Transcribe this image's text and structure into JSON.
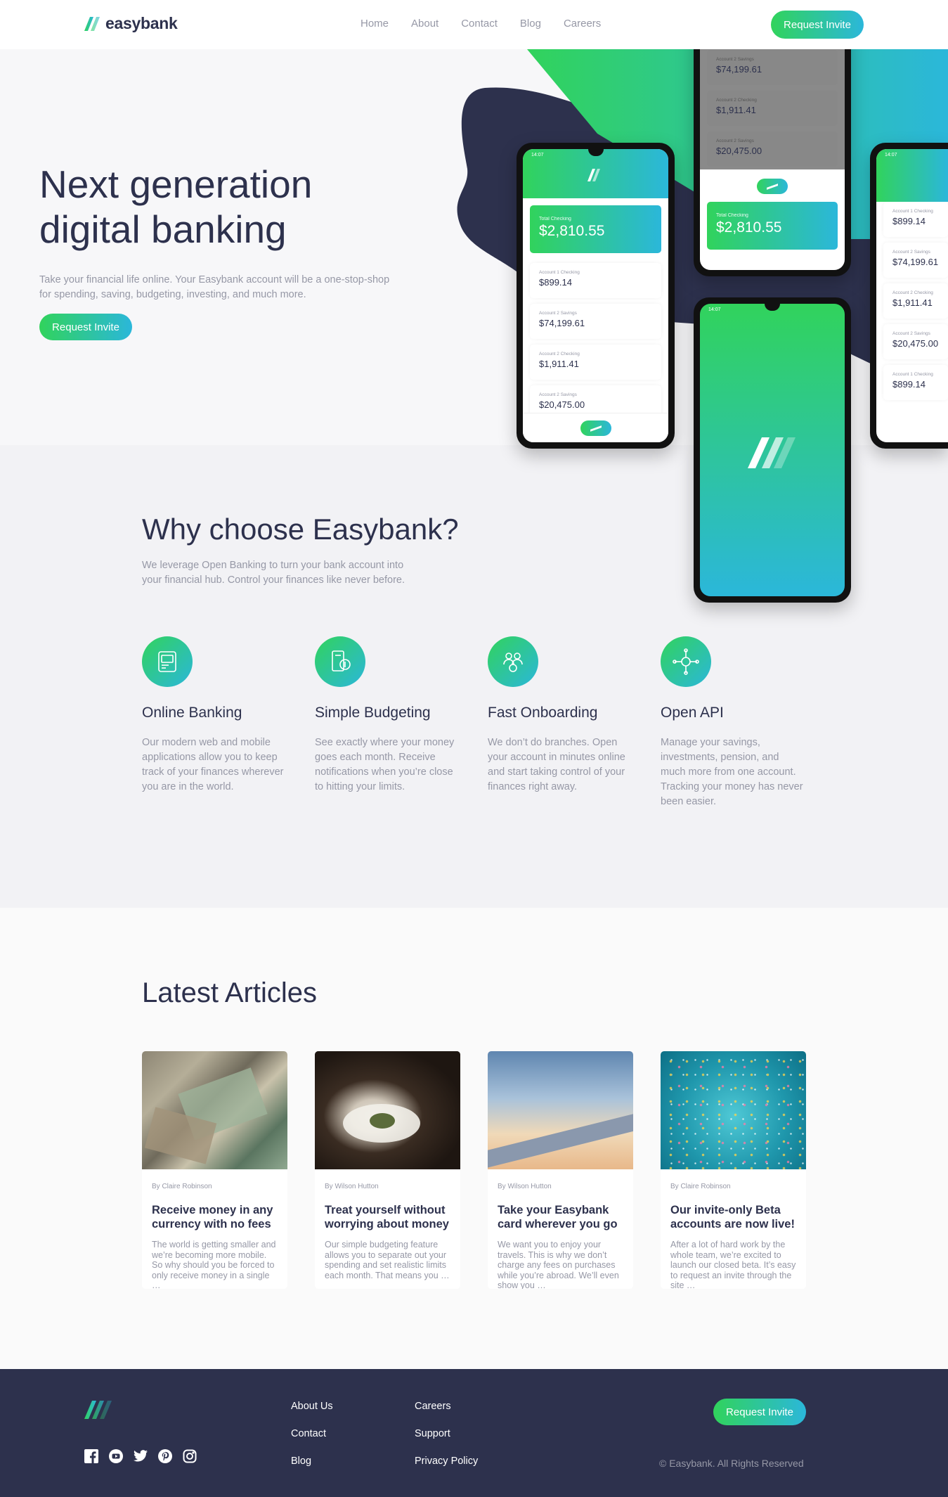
{
  "header": {
    "brand": "easybank",
    "nav": [
      "Home",
      "About",
      "Contact",
      "Blog",
      "Careers"
    ],
    "cta": "Request Invite"
  },
  "hero": {
    "title_line1": "Next generation",
    "title_line2": "digital banking",
    "description": "Take your financial life online. Your Easybank account will be a one-stop-shop for spending, saving, budgeting, investing, and much more.",
    "cta": "Request Invite"
  },
  "phones": {
    "time": "14:07",
    "total_label": "Total Checking",
    "total_value": "$2,810.55",
    "accounts": [
      {
        "label": "Account 1 Checking",
        "value": "$899.14"
      },
      {
        "label": "Account 2 Savings",
        "value": "$74,199.61"
      },
      {
        "label": "Account 2 Checking",
        "value": "$1,911.41"
      },
      {
        "label": "Account 2 Savings",
        "value": "$20,475.00"
      },
      {
        "label": "Account 1 Checking",
        "value": "$899.14"
      }
    ]
  },
  "why": {
    "title": "Why choose Easybank?",
    "description": "We leverage Open Banking to turn your bank account into your financial hub. Control your finances like never before.",
    "features": [
      {
        "icon": "online-banking-icon",
        "title": "Online Banking",
        "text": "Our modern web and mobile applications allow you to keep track of your finances wherever you are in the world."
      },
      {
        "icon": "budgeting-icon",
        "title": "Simple Budgeting",
        "text": "See exactly where your money goes each month. Receive notifications when you’re close to hitting your limits."
      },
      {
        "icon": "onboarding-icon",
        "title": "Fast Onboarding",
        "text": "We don’t do branches. Open your account in minutes online and start taking control of your finances right away."
      },
      {
        "icon": "api-icon",
        "title": "Open API",
        "text": "Manage your savings, investments, pension, and much more from one account. Tracking your money has never been easier."
      }
    ]
  },
  "articles": {
    "title": "Latest Articles",
    "items": [
      {
        "author": "By Claire Robinson",
        "title": "Receive money in any currency with no fees",
        "excerpt": "The world is getting smaller and we’re becoming more mobile. So why should you be forced to only receive money in a single …"
      },
      {
        "author": "By Wilson Hutton",
        "title": "Treat yourself without worrying about money",
        "excerpt": "Our simple budgeting feature allows you to separate out your spending and set realistic limits each month. That means you …"
      },
      {
        "author": "By Wilson Hutton",
        "title": "Take your Easybank card wherever you go",
        "excerpt": "We want you to enjoy your travels. This is why we don’t charge any fees on purchases while you’re abroad. We’ll even show you …"
      },
      {
        "author": "By Claire Robinson",
        "title": "Our invite-only Beta accounts are now live!",
        "excerpt": "After a lot of hard work by the whole team, we’re excited to launch our closed beta. It’s easy to request an invite through the site …"
      }
    ]
  },
  "footer": {
    "links_col1": [
      "About Us",
      "Contact",
      "Blog"
    ],
    "links_col2": [
      "Careers",
      "Support",
      "Privacy Policy"
    ],
    "cta": "Request Invite",
    "copyright": "© Easybank. All Rights Reserved",
    "socials": [
      "facebook-icon",
      "youtube-icon",
      "twitter-icon",
      "pinterest-icon",
      "instagram-icon"
    ]
  },
  "colors": {
    "dark_blue": "#2d314d",
    "lime_green": "#31d35c",
    "bright_cyan": "#2bb7da",
    "grayish_blue": "#9698a6",
    "light_gray": "#f2f2f5"
  }
}
